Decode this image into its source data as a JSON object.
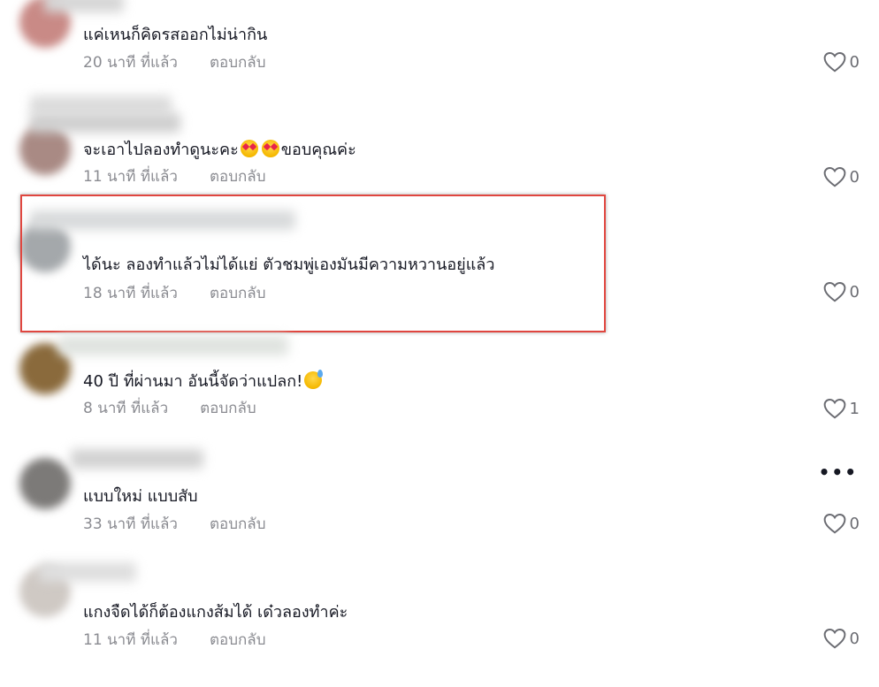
{
  "colors": {
    "text": "#161823",
    "meta": "#8a8b91",
    "highlight": "#e0463f"
  },
  "comments": [
    {
      "text": "แค่เหนก็คิดรสออกไม่น่ากิน",
      "time": "20 นาที ที่แล้ว",
      "reply": "ตอบกลับ",
      "likes": "0"
    },
    {
      "text_a": "จะเอาไปลองทำดูนะคะ",
      "text_b": "ขอบคุณค่ะ",
      "emoji": "smiling-face-with-heart-eyes",
      "time": "11 นาที ที่แล้ว",
      "reply": "ตอบกลับ",
      "likes": "0"
    },
    {
      "text": "ได้นะ ลองทำแล้วไม่ได้แย่ ตัวชมพู่เองมันมีความหวานอยู่แล้ว",
      "time": "18 นาที ที่แล้ว",
      "reply": "ตอบกลับ",
      "likes": "0",
      "highlighted": true
    },
    {
      "text": "40 ปี ที่ผ่านมา อันนี้จัดว่าแปลก!",
      "emoji": "grinning-face-with-sweat",
      "time": "8 นาที ที่แล้ว",
      "reply": "ตอบกลับ",
      "likes": "1"
    },
    {
      "text": "แบบใหม่ แบบสับ",
      "time": "33 นาที ที่แล้ว",
      "reply": "ตอบกลับ",
      "likes": "0",
      "more": "•••"
    },
    {
      "text": "แกงจืดได้ก็ต้องแกงส้มได้ เด๋วลองทำค่ะ",
      "time": "11 นาที ที่แล้ว",
      "reply": "ตอบกลับ",
      "likes": "0"
    }
  ]
}
